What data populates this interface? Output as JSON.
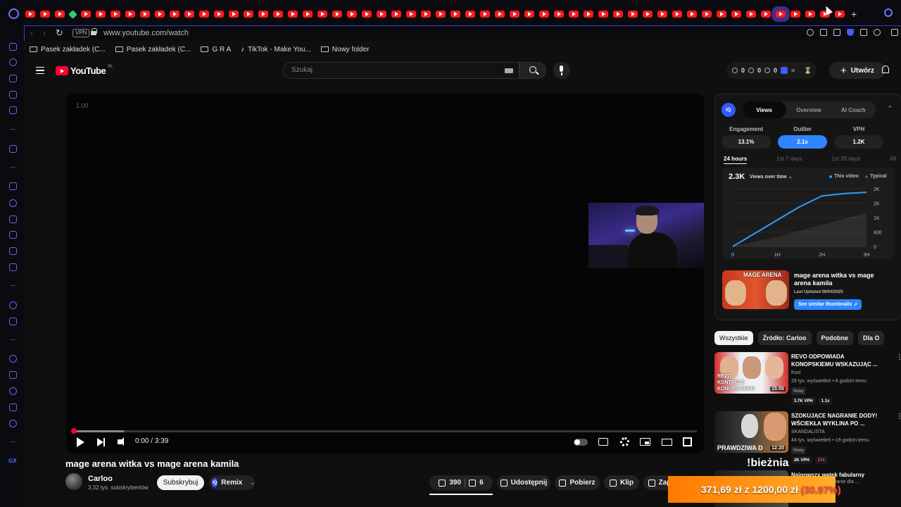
{
  "browser": {
    "url": "www.youtube.com/watch",
    "vpn_label": "VPN",
    "tab_count_visible": 56,
    "bookmarks": [
      {
        "label": "Pasek zakładek (C...",
        "icon": "folder-icon"
      },
      {
        "label": "Pasek zakładek (C...",
        "icon": "folder-icon"
      },
      {
        "label": "G R A",
        "icon": "folder-icon"
      },
      {
        "label": "TikTok - Make You...",
        "icon": "tiktok-icon"
      },
      {
        "label": "Nowy folder",
        "icon": "folder-icon"
      }
    ],
    "colors": {
      "accent": "#5a6bff",
      "tab_youtube": "#ff1a1a"
    }
  },
  "youtube": {
    "logo_text": "YouTube",
    "region": "PL",
    "search_placeholder": "Szukaj",
    "stats_pill": {
      "v1": "0",
      "v2": "0",
      "v3": "0"
    },
    "create_label": "Utwórz"
  },
  "player": {
    "speed": "1.00",
    "time": "0:00 / 3:39",
    "progress_fraction": 0.0
  },
  "video": {
    "title": "mage arena witka vs mage arena kamila",
    "channel": "Carloo",
    "subscribers": "3,32 tys. subskrybentów",
    "subscribe_label": "Subskrybuj",
    "remix_label": "Remix",
    "likes": "390",
    "dislikes": "6",
    "share_label": "Udostępnij",
    "download_label": "Pobierz",
    "clip_label": "Klip",
    "save_label": "Zap"
  },
  "iq": {
    "logo": "IQ",
    "tabs": [
      "Views",
      "Overview",
      "AI Coach"
    ],
    "active_tab": "Views",
    "metrics": [
      {
        "label": "Engagement",
        "value": "13.1%"
      },
      {
        "label": "Outlier",
        "value": "2.1x"
      },
      {
        "label": "VPH",
        "value": "1.2K"
      }
    ],
    "periods": [
      "24 hours",
      "1st 7 days",
      "1st 28 days",
      "All"
    ],
    "active_period": "24 hours",
    "chart_total": "2.3K",
    "chart_mode": "Views over time",
    "legend_this": "This video",
    "legend_typical": "Typical",
    "video_title": "mage arena witka vs mage arena kamila",
    "last_updated": "Last Updated 08/04/2025",
    "similar_label": "See similar thumbnails",
    "thumb_text": "MAGE ARENA"
  },
  "chart_data": {
    "type": "line",
    "title": "",
    "x": [
      "0",
      "1H",
      "2H",
      "3H"
    ],
    "xlabel": "",
    "ylabel": "",
    "y_ticks": [
      "0",
      "600",
      "1K",
      "2K",
      "2K"
    ],
    "ylim": [
      0,
      2400
    ],
    "series": [
      {
        "name": "This video",
        "color": "#2d9cff",
        "x": [
          0,
          0.5,
          1,
          1.5,
          2,
          2.5,
          3
        ],
        "values": [
          0,
          550,
          1100,
          1650,
          2100,
          2200,
          2250
        ]
      },
      {
        "name": "Typical",
        "color": "#555555",
        "x": [
          0,
          1,
          2,
          3
        ],
        "values": [
          0,
          400,
          900,
          1400
        ]
      }
    ]
  },
  "chips": [
    "Wszystkie",
    "Źródło: Carloo",
    "Podobne",
    "Dla C"
  ],
  "recommendations": [
    {
      "title": "REVO ODPOWIADA KONOPSKIEMU WSKAZUJĄC ...",
      "channel": "Kozi",
      "meta": "29 tys. wyświetleń • 8 godzin temu",
      "badge": "Nowy",
      "tags": [
        "3.7K VPH",
        "1.1x"
      ],
      "duration": "15:55",
      "thumb_caption": "REVO KONTRUJE KONOPSKIEGO"
    },
    {
      "title": "SZOKUJĄCE NAGRANIE DODY! WŚCIEKŁA WYKLINA PO ...",
      "channel": "SKANDALISTA",
      "meta": "44 tys. wyświetleń • 19 godzin temu",
      "badge": "Nowy",
      "tags": [
        "2K VPH",
        "17x"
      ],
      "duration": "12:20",
      "thumb_caption": "PRAWDZIWA D"
    },
    {
      "title": "Najnowszy wątek fabularny",
      "line2": "Bajtek stanowi wyzwanie dla ..."
    }
  ],
  "overlay": {
    "command": "!bieżnia",
    "donation_amount": "371,69 zł",
    "donation_sep": "z",
    "donation_goal": "1200,00 zł",
    "donation_pct": "(30.97%)"
  }
}
